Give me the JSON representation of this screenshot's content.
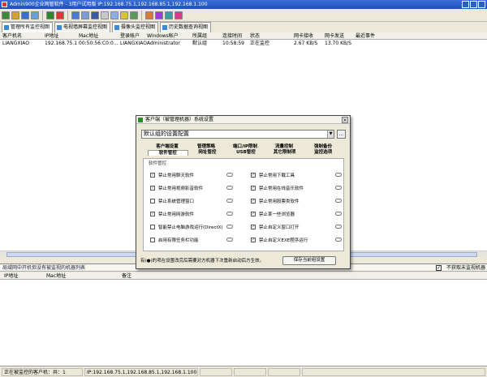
{
  "window": {
    "title": "Admin900企业网管软件 - 3用户试用版 IP:192.168.75.1,192.168.85.1,192.168.1.100"
  },
  "tabs": [
    {
      "label": "管理所有监控视图"
    },
    {
      "label": "电视墙屏幕监控视图"
    },
    {
      "label": "摄像头监控视图"
    },
    {
      "label": "历史数据查询视图"
    }
  ],
  "clients_table": {
    "columns": [
      "客户机名",
      "IP地址",
      "Mac地址",
      "登录帐户",
      "Windows帐户",
      "所属组",
      "连接时间",
      "状态",
      "网卡接收",
      "网卡发送",
      "最近事件"
    ],
    "rows": [
      [
        "LIANGXIAO",
        "192.168.75.1",
        "00:50:56:C0:0...",
        "LIANGXIAO",
        "Administrator",
        "默认组",
        "10:58:59",
        "正在监控",
        "2.67 KB/S",
        "13.70 KB/S",
        ""
      ]
    ]
  },
  "lower_section": {
    "title": "局域网中开机但没有被监视的机器列表",
    "checkbox_label": "不获取未监视机器",
    "checkbox_checked": true,
    "columns": [
      "IP地址",
      "Mac地址",
      "备注"
    ]
  },
  "statusbar": {
    "cells": [
      "正在被监控的客户机：共：1",
      "IP:192.168.75.1,192.168.85.1,192.168.1.100"
    ]
  },
  "dialog": {
    "title": "客户端（被管理机器）系统设置",
    "close_glyph": "×",
    "combo_value": "默认组的设置配置",
    "more_label": "...",
    "tabs_row1": [
      "客户端设置",
      "管理策略",
      "端口/IP限制",
      "流量控制",
      "强制备份"
    ],
    "tabs_row2": [
      "软件管控",
      "网址管控",
      "USB管控",
      "其它限制项",
      "监控选项"
    ],
    "group_title": "软件管控",
    "options_left": [
      {
        "label": "禁止常用聊天软件",
        "checked": true
      },
      {
        "label": "禁止常用视频影音软件",
        "checked": true
      },
      {
        "label": "禁止系统管理窗口",
        "checked": false
      },
      {
        "label": "禁止常用网游软件",
        "checked": true
      },
      {
        "label": "智能禁止电脑游戏运行(DirectX)",
        "checked": false
      },
      {
        "label": "启用有限任务栏功能",
        "checked": false
      }
    ],
    "options_right": [
      {
        "label": "禁止常用下载工具",
        "checked": true
      },
      {
        "label": "禁止常用在线音乐软件",
        "checked": true
      },
      {
        "label": "禁止常用股票类软件",
        "checked": true
      },
      {
        "label": "禁止某一些浏览器",
        "checked": true
      },
      {
        "label": "禁止自定义窗口打开",
        "checked": true
      },
      {
        "label": "禁止自定义EXE程序运行",
        "checked": true
      }
    ],
    "note": "有(●)的项在设置改完后需要对方机器下次重新启动后方生效。",
    "save_label": "保存当前组设置",
    "check_glyph": "✓"
  },
  "colors": {
    "titlebar": "#1d4fb8",
    "toolbar_bg": "#ece9d8",
    "accent": "#3a8ad8"
  }
}
